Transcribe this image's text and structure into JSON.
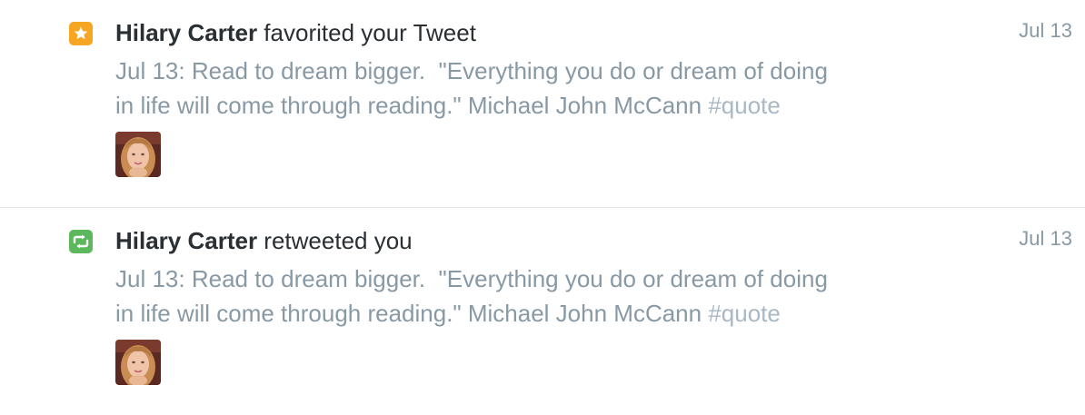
{
  "colors": {
    "favorite_badge": "#f6a623",
    "retweet_badge": "#5cb85c",
    "name_text": "#292f33",
    "muted_text": "#8899a6",
    "divider": "#e1e8ed"
  },
  "notifications": [
    {
      "type": "favorite",
      "icon": "star-icon",
      "user_name": "Hilary Carter",
      "action": " favorited your Tweet",
      "date": "Jul 13",
      "tweet_line1": "Jul 13: Read to dream bigger.  \"Everything you do or dream of doing",
      "tweet_line2": "in life will come through reading.\" Michael John McCann ",
      "hashtag": "#quote",
      "avatar": "user-avatar"
    },
    {
      "type": "retweet",
      "icon": "retweet-icon",
      "user_name": "Hilary Carter",
      "action": " retweeted you",
      "date": "Jul 13",
      "tweet_line1": "Jul 13: Read to dream bigger.  \"Everything you do or dream of doing",
      "tweet_line2": "in life will come through reading.\" Michael John McCann ",
      "hashtag": "#quote",
      "avatar": "user-avatar"
    }
  ]
}
